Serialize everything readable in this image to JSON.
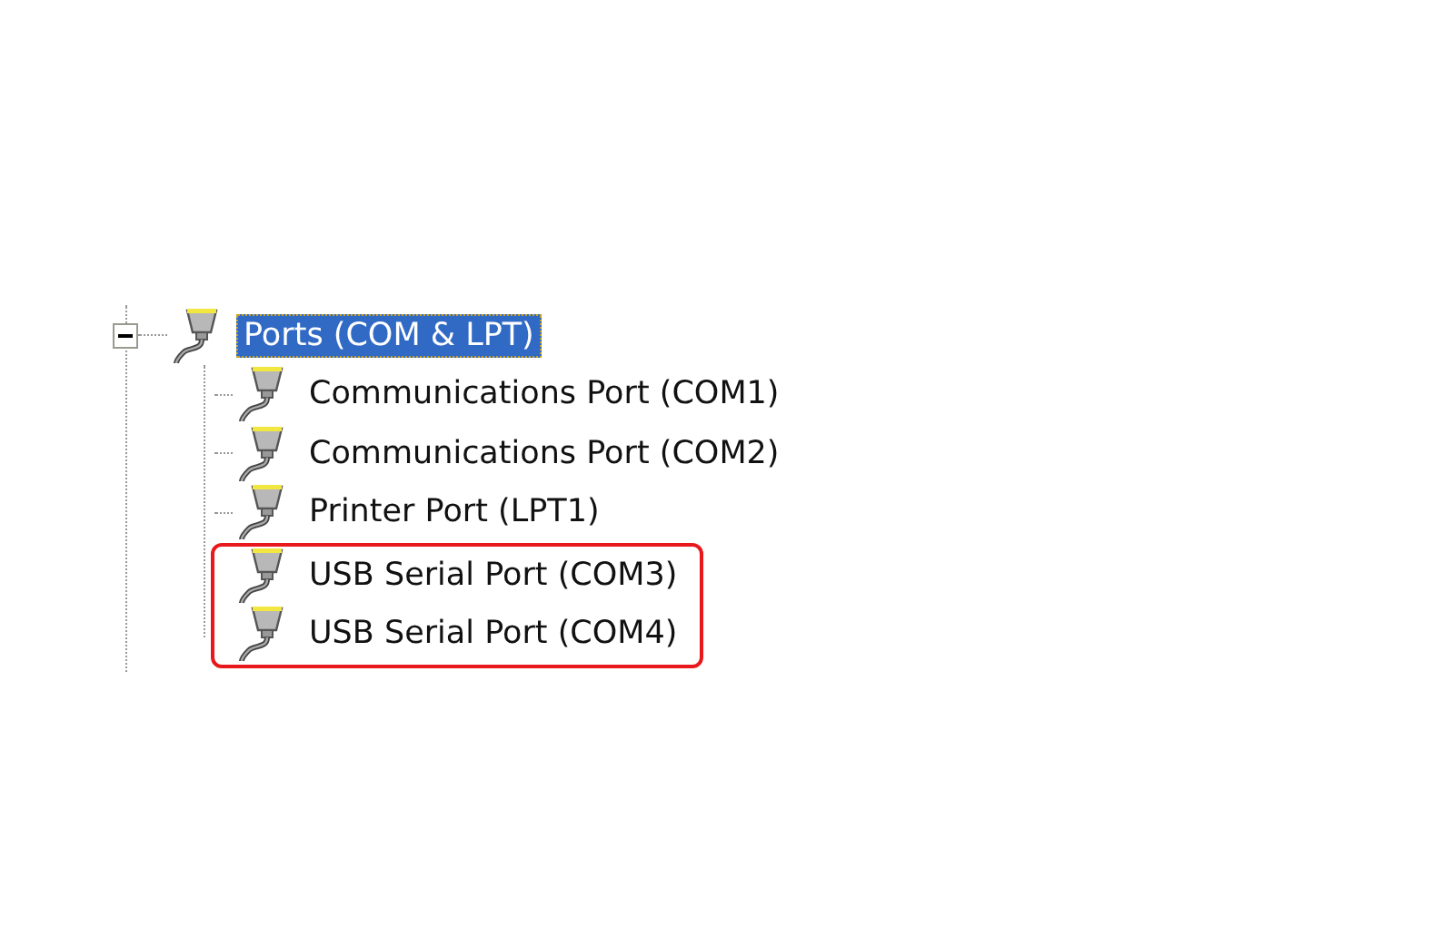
{
  "tree": {
    "label": "Ports (COM & LPT)",
    "expanded": true,
    "selected": true,
    "children": [
      {
        "label": "Communications Port (COM1)",
        "highlighted": false
      },
      {
        "label": "Communications Port (COM2)",
        "highlighted": false
      },
      {
        "label": "Printer Port (LPT1)",
        "highlighted": false
      },
      {
        "label": "USB Serial Port (COM3)",
        "highlighted": true
      },
      {
        "label": "USB Serial Port (COM4)",
        "highlighted": true
      }
    ]
  }
}
